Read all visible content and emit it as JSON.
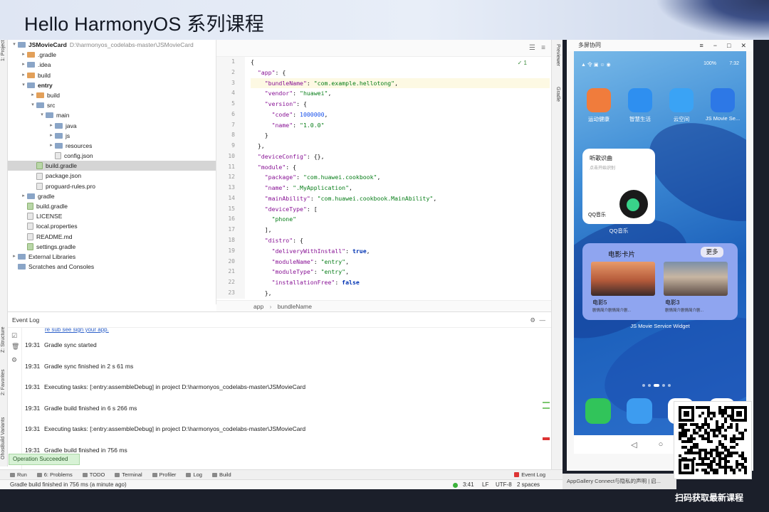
{
  "banner": {
    "title": "Hello HarmonyOS 系列课程"
  },
  "sidebar_tabs": {
    "project": "1: Project",
    "structure": "Z: Structure",
    "favorites": "2: Favorites",
    "variants": "OhosBuild Variants"
  },
  "right_tabs": {
    "previewer": "Previewer",
    "gradle": "Gradle"
  },
  "project_tree": [
    {
      "label": "JSMovieCard",
      "path": "D:\\harmonyos_codelabs-master\\JSMovieCard",
      "depth": 0,
      "arrow": "▾",
      "icon": "fold",
      "bold": true
    },
    {
      "label": ".gradle",
      "depth": 1,
      "arrow": "▸",
      "icon": "fold-orange"
    },
    {
      "label": ".idea",
      "depth": 1,
      "arrow": "▸",
      "icon": "fold"
    },
    {
      "label": "build",
      "depth": 1,
      "arrow": "▸",
      "icon": "fold-orange"
    },
    {
      "label": "entry",
      "depth": 1,
      "arrow": "▾",
      "icon": "fold",
      "bold": true
    },
    {
      "label": "build",
      "depth": 2,
      "arrow": "▸",
      "icon": "fold-orange"
    },
    {
      "label": "src",
      "depth": 2,
      "arrow": "▾",
      "icon": "fold"
    },
    {
      "label": "main",
      "depth": 3,
      "arrow": "▾",
      "icon": "fold"
    },
    {
      "label": "java",
      "depth": 4,
      "arrow": "▸",
      "icon": "fold"
    },
    {
      "label": "js",
      "depth": 4,
      "arrow": "▸",
      "icon": "fold"
    },
    {
      "label": "resources",
      "depth": 4,
      "arrow": "▸",
      "icon": "fold"
    },
    {
      "label": "config.json",
      "depth": 4,
      "arrow": "",
      "icon": "file"
    },
    {
      "label": "build.gradle",
      "depth": 2,
      "arrow": "",
      "icon": "file-g",
      "selected": true
    },
    {
      "label": "package.json",
      "depth": 2,
      "arrow": "",
      "icon": "file"
    },
    {
      "label": "proguard-rules.pro",
      "depth": 2,
      "arrow": "",
      "icon": "file"
    },
    {
      "label": "gradle",
      "depth": 1,
      "arrow": "▸",
      "icon": "fold"
    },
    {
      "label": "build.gradle",
      "depth": 1,
      "arrow": "",
      "icon": "file-g"
    },
    {
      "label": "LICENSE",
      "depth": 1,
      "arrow": "",
      "icon": "file"
    },
    {
      "label": "local.properties",
      "depth": 1,
      "arrow": "",
      "icon": "file"
    },
    {
      "label": "README.md",
      "depth": 1,
      "arrow": "",
      "icon": "file"
    },
    {
      "label": "settings.gradle",
      "depth": 1,
      "arrow": "",
      "icon": "file-g"
    },
    {
      "label": "External Libraries",
      "depth": 0,
      "arrow": "▸",
      "icon": "fold"
    },
    {
      "label": "Scratches and Consoles",
      "depth": 0,
      "arrow": "",
      "icon": "fold"
    }
  ],
  "editor": {
    "warning": "1",
    "lines": [
      [
        [
          "p",
          "{"
        ]
      ],
      [
        [
          "p",
          "  "
        ],
        [
          "k",
          "\"app\""
        ],
        [
          "p",
          ": {"
        ]
      ],
      [
        [
          "p",
          "    "
        ],
        [
          "k",
          "\"bundleName\""
        ],
        [
          "p",
          ": "
        ],
        [
          "s",
          "\"com.example.hellotong\""
        ],
        [
          "p",
          ","
        ]
      ],
      [
        [
          "p",
          "    "
        ],
        [
          "k",
          "\"vendor\""
        ],
        [
          "p",
          ": "
        ],
        [
          "s",
          "\"huawei\""
        ],
        [
          "p",
          ","
        ]
      ],
      [
        [
          "p",
          "    "
        ],
        [
          "k",
          "\"version\""
        ],
        [
          "p",
          ": {"
        ]
      ],
      [
        [
          "p",
          "      "
        ],
        [
          "k",
          "\"code\""
        ],
        [
          "p",
          ": "
        ],
        [
          "n",
          "1000000"
        ],
        [
          "p",
          ","
        ]
      ],
      [
        [
          "p",
          "      "
        ],
        [
          "k",
          "\"name\""
        ],
        [
          "p",
          ": "
        ],
        [
          "s",
          "\"1.0.0\""
        ]
      ],
      [
        [
          "p",
          "    }"
        ]
      ],
      [
        [
          "p",
          "  },"
        ]
      ],
      [
        [
          "p",
          "  "
        ],
        [
          "k",
          "\"deviceConfig\""
        ],
        [
          "p",
          ": {},"
        ]
      ],
      [
        [
          "p",
          "  "
        ],
        [
          "k",
          "\"module\""
        ],
        [
          "p",
          ": {"
        ]
      ],
      [
        [
          "p",
          "    "
        ],
        [
          "k",
          "\"package\""
        ],
        [
          "p",
          ": "
        ],
        [
          "s",
          "\"com.huawei.cookbook\""
        ],
        [
          "p",
          ","
        ]
      ],
      [
        [
          "p",
          "    "
        ],
        [
          "k",
          "\"name\""
        ],
        [
          "p",
          ": "
        ],
        [
          "s",
          "\".MyApplication\""
        ],
        [
          "p",
          ","
        ]
      ],
      [
        [
          "p",
          "    "
        ],
        [
          "k",
          "\"mainAbility\""
        ],
        [
          "p",
          ": "
        ],
        [
          "s",
          "\"com.huawei.cookbook.MainAbility\""
        ],
        [
          "p",
          ","
        ]
      ],
      [
        [
          "p",
          "    "
        ],
        [
          "k",
          "\"deviceType\""
        ],
        [
          "p",
          ": ["
        ]
      ],
      [
        [
          "p",
          "      "
        ],
        [
          "s",
          "\"phone\""
        ]
      ],
      [
        [
          "p",
          "    ],"
        ]
      ],
      [
        [
          "p",
          "    "
        ],
        [
          "k",
          "\"distro\""
        ],
        [
          "p",
          ": {"
        ]
      ],
      [
        [
          "p",
          "      "
        ],
        [
          "k",
          "\"deliveryWithInstall\""
        ],
        [
          "p",
          ": "
        ],
        [
          "kw",
          "true"
        ],
        [
          "p",
          ","
        ]
      ],
      [
        [
          "p",
          "      "
        ],
        [
          "k",
          "\"moduleName\""
        ],
        [
          "p",
          ": "
        ],
        [
          "s",
          "\"entry\""
        ],
        [
          "p",
          ","
        ]
      ],
      [
        [
          "p",
          "      "
        ],
        [
          "k",
          "\"moduleType\""
        ],
        [
          "p",
          ": "
        ],
        [
          "s",
          "\"entry\""
        ],
        [
          "p",
          ","
        ]
      ],
      [
        [
          "p",
          "      "
        ],
        [
          "k",
          "\"installationFree\""
        ],
        [
          "p",
          ": "
        ],
        [
          "kw",
          "false"
        ]
      ],
      [
        [
          "p",
          "    },"
        ]
      ]
    ],
    "highlight_line": 3,
    "breadcrumb": [
      "app",
      "bundleName"
    ]
  },
  "event_log": {
    "title": "Event Log",
    "top_link": "re sub see sign your app.",
    "entries": [
      {
        "time": "19:31",
        "text": "Gradle sync started"
      },
      {
        "time": "19:31",
        "text": "Gradle sync finished in 2 s 61 ms"
      },
      {
        "time": "19:31",
        "text": "Executing tasks: [:entry:assembleDebug] in project D:\\harmonyos_codelabs-master\\JSMovieCard"
      },
      {
        "time": "19:31",
        "text": "Gradle build finished in 6 s 266 ms"
      },
      {
        "time": "19:31",
        "text": "Executing tasks: [:entry:assembleDebug] in project D:\\harmonyos_codelabs-master\\JSMovieCard"
      },
      {
        "time": "19:31",
        "text": "Gradle build finished in 756 ms"
      }
    ]
  },
  "toast": "Operation Succeeded",
  "bottom_tools": [
    "Run",
    "6: Problems",
    "TODO",
    "Terminal",
    "Profiler",
    "Log",
    "Build"
  ],
  "event_log_tab": "Event Log",
  "status": {
    "message": "Gradle build finished in 756 ms (a minute ago)",
    "position": "3:41",
    "line_sep": "LF",
    "encoding": "UTF-8",
    "indent": "2 spaces"
  },
  "phone_window": {
    "title": "多屏协同",
    "status_left": "▲ 令 ▣ ☺ ◉",
    "battery": "100%",
    "clock": "7:32",
    "apps": [
      {
        "label": "运动健康",
        "color": "#f07c3c"
      },
      {
        "label": "智慧生活",
        "color": "#2e8ff0"
      },
      {
        "label": "云空间",
        "color": "#3aa3f5"
      },
      {
        "label": "JS Movie Se...",
        "color": "#2d78e6"
      }
    ],
    "qq_card": {
      "title": "听歌识曲",
      "subtitle": "点击开始识别",
      "name": "QQ音乐",
      "label": "QQ音乐"
    },
    "movie_card": {
      "title": "电影卡片",
      "more": "更多",
      "items": [
        {
          "name": "电影5",
          "desc": "剧情简介剧情简介剧..."
        },
        {
          "name": "电影3",
          "desc": "剧情简介剧情简介剧..."
        }
      ],
      "label": "JS Movie Service Widget"
    },
    "dock": [
      {
        "color": "#31c45a"
      },
      {
        "color": "#3d9cf0"
      },
      {
        "color": "#ffffff"
      },
      {
        "color": "#ffffff"
      }
    ],
    "nav": [
      "◁",
      "○",
      "□"
    ]
  },
  "bottom_strip": "AppGallery Connect与隐私的声明 | 启...",
  "qr_caption": "扫码获取最新课程"
}
